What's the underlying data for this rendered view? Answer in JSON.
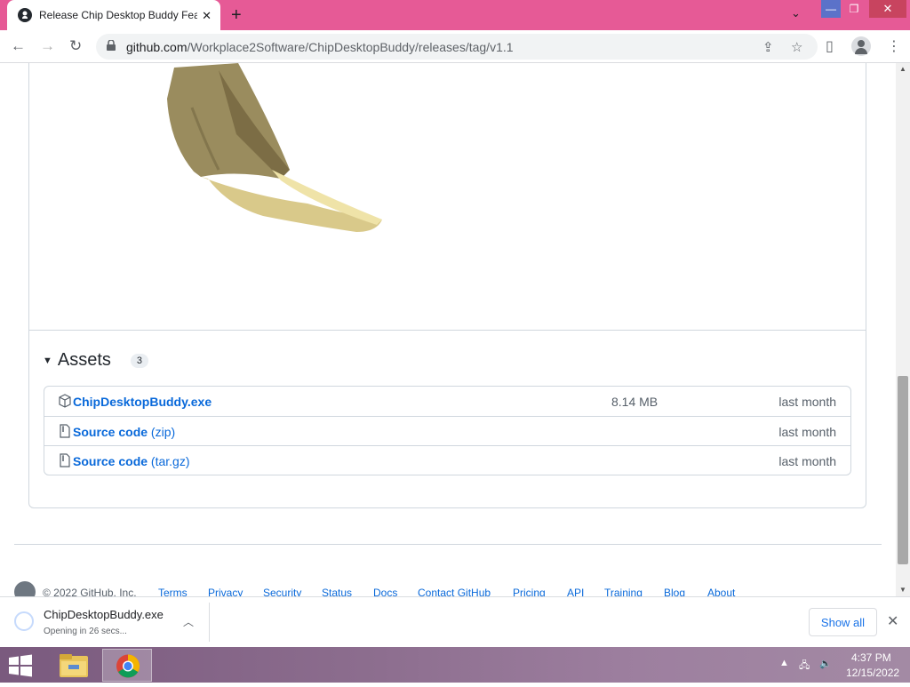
{
  "browser": {
    "tab_title": "Release Chip Desktop Buddy Fea",
    "url_host": "github.com",
    "url_path": "/Workplace2Software/ChipDesktopBuddy/releases/tag/v1.1"
  },
  "assets": {
    "title": "Assets",
    "count": "3",
    "items": [
      {
        "name": "ChipDesktopBuddy.exe",
        "suffix": "",
        "size": "8.14 MB",
        "date": "last month"
      },
      {
        "name": "Source code",
        "suffix": " (zip)",
        "size": "",
        "date": "last month"
      },
      {
        "name": "Source code",
        "suffix": " (tar.gz)",
        "size": "",
        "date": "last month"
      }
    ]
  },
  "footer": {
    "copyright": "© 2022 GitHub, Inc.",
    "links": [
      "Terms",
      "Privacy",
      "Security",
      "Status",
      "Docs",
      "Contact GitHub",
      "Pricing",
      "API",
      "Training",
      "Blog",
      "About"
    ]
  },
  "download": {
    "filename": "ChipDesktopBuddy.exe",
    "status": "Opening in 26 secs...",
    "show_all": "Show all"
  },
  "taskbar": {
    "time": "4:37 PM",
    "date": "12/15/2022"
  },
  "colors": {
    "tabbar": "#e65a96",
    "link": "#0969da",
    "taskbar": "#8c6d8e"
  }
}
